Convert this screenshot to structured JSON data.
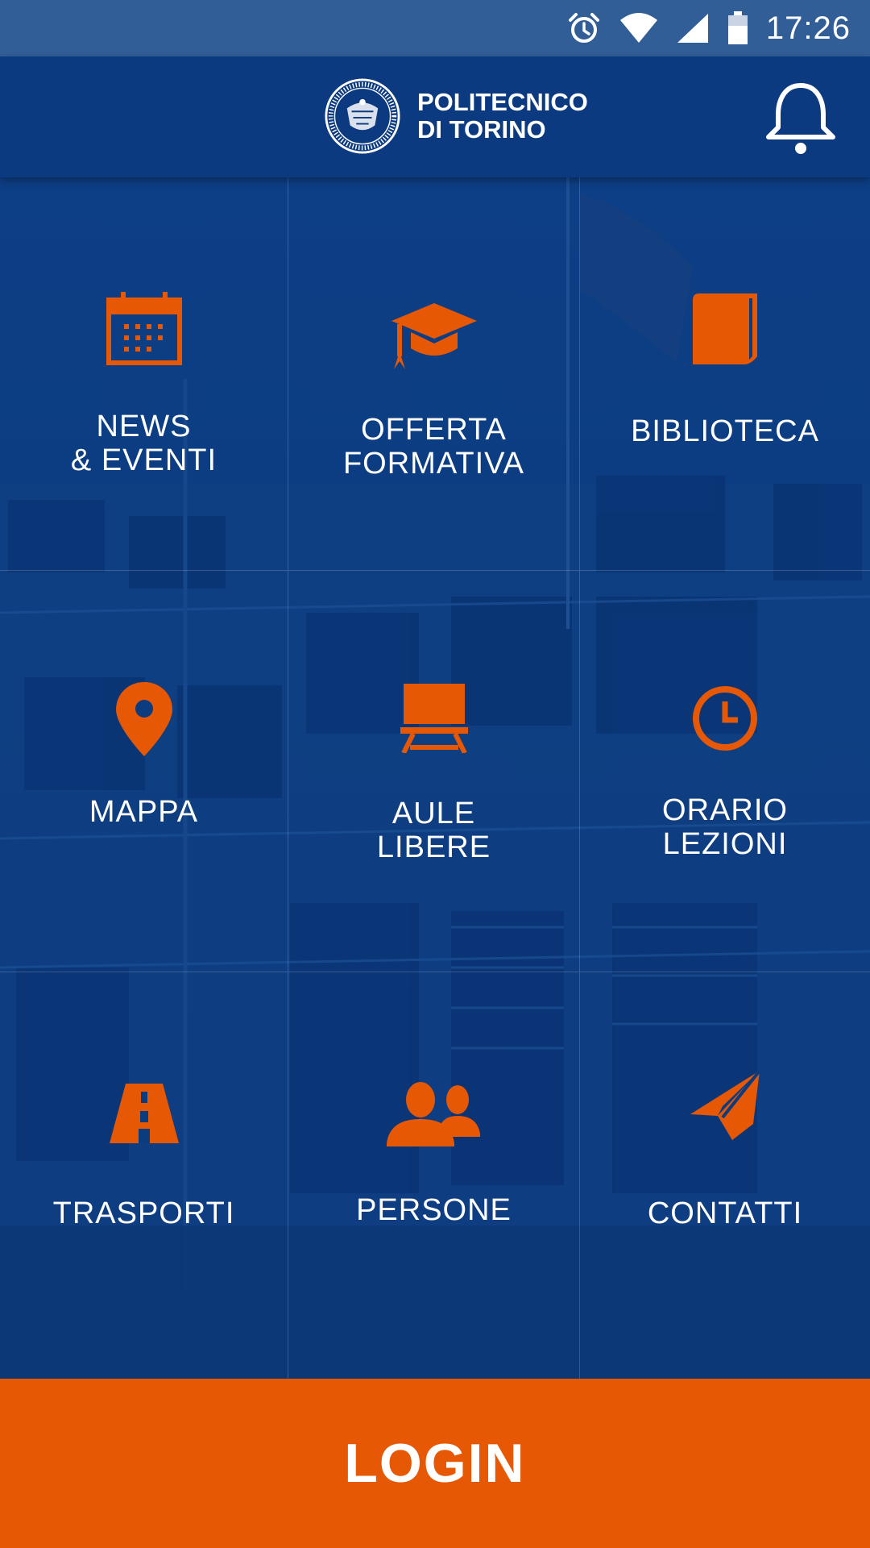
{
  "status_bar": {
    "time": "17:26",
    "icons": [
      "alarm-icon",
      "wifi-icon",
      "signal-icon",
      "battery-icon"
    ]
  },
  "header": {
    "brand_line1": "POLITECNICO",
    "brand_line2": "DI TORINO",
    "seal_text": "POLITECNICO DI TORINO",
    "seal_year_left": "1859",
    "seal_year_right": "1906",
    "notification_icon": "bell-icon"
  },
  "tiles": [
    {
      "label": "NEWS\n& EVENTI",
      "icon": "calendar-icon"
    },
    {
      "label": "OFFERTA\nFORMATIVA",
      "icon": "graduation-cap-icon"
    },
    {
      "label": "BIBLIOTECA",
      "icon": "book-icon"
    },
    {
      "label": "MAPPA",
      "icon": "map-pin-icon"
    },
    {
      "label": "AULE\nLIBERE",
      "icon": "classroom-desk-icon"
    },
    {
      "label": "ORARIO\nLEZIONI",
      "icon": "clock-icon"
    },
    {
      "label": "TRASPORTI",
      "icon": "road-icon"
    },
    {
      "label": "PERSONE",
      "icon": "people-icon"
    },
    {
      "label": "CONTATTI",
      "icon": "paper-plane-icon"
    }
  ],
  "login": {
    "label": "LOGIN"
  },
  "colors": {
    "accent": "#e75804",
    "header_bg": "#0b3a80",
    "status_bg": "#325e97",
    "overlay_blue": "#0c3c80"
  }
}
